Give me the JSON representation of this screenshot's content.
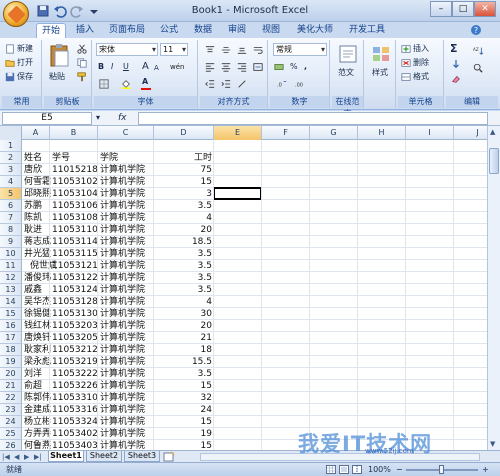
{
  "window": {
    "title": "Book1 - Microsoft Excel",
    "minimize": "–",
    "maximize": "□",
    "close": "✕"
  },
  "tabs": [
    "开始",
    "插入",
    "页面布局",
    "公式",
    "数据",
    "审阅",
    "视图",
    "美化大师",
    "开发工具"
  ],
  "ribbon": {
    "clipboard": {
      "new": "新建",
      "open": "打开",
      "save": "保存",
      "paste": "粘贴",
      "group_common": "常用",
      "group_clipboard": "剪贴板"
    },
    "font": {
      "name": "宋体",
      "size": "11",
      "bold": "B",
      "italic": "I",
      "underline": "U",
      "grow": "A",
      "shrink": "A",
      "fill_color": "A",
      "font_color": "A",
      "group": "字体",
      "phonetic": "wén"
    },
    "alignment": {
      "group": "对齐方式"
    },
    "number": {
      "format": "常规",
      "percent": "%",
      "comma": ",",
      "group": "数字"
    },
    "style": {
      "online_style": "范文",
      "style": "样式",
      "group_online": "在线范文"
    },
    "cells": {
      "insert": "插入",
      "delete": "删除",
      "format": "格式",
      "group": "单元格"
    },
    "editing": {
      "sum": "Σ",
      "group": "编辑"
    }
  },
  "formula_bar": {
    "name_box": "E5",
    "fx": "fx"
  },
  "columns": [
    "A",
    "B",
    "C",
    "D",
    "E",
    "F",
    "G",
    "H",
    "I",
    "J"
  ],
  "active_cell": {
    "col": "E",
    "row": "5"
  },
  "rows": [
    {
      "n": "1",
      "a": "",
      "b": "",
      "c": "",
      "d": ""
    },
    {
      "n": "2",
      "a": "姓名",
      "b": "学号",
      "c": "学院",
      "d": "工时"
    },
    {
      "n": "3",
      "a": "唐欣",
      "b": "11015218",
      "c": "计算机学院",
      "d": "75"
    },
    {
      "n": "4",
      "a": "何雪霜",
      "b": "11053102",
      "c": "计算机学院",
      "d": "15"
    },
    {
      "n": "5",
      "a": "邱晓熙",
      "b": "11053104",
      "c": "计算机学院",
      "d": "3"
    },
    {
      "n": "6",
      "a": "苏鹏",
      "b": "11053106",
      "c": "计算机学院",
      "d": "3.5"
    },
    {
      "n": "7",
      "a": "陈凯",
      "b": "11053108",
      "c": "计算机学院",
      "d": "4"
    },
    {
      "n": "8",
      "a": "耿进",
      "b": "11053110",
      "c": "计算机学院",
      "d": "20"
    },
    {
      "n": "9",
      "a": "蒋志成",
      "b": "11053114",
      "c": "计算机学院",
      "d": "18.5"
    },
    {
      "n": "10",
      "a": "井光猛",
      "b": "11053115",
      "c": "计算机学院",
      "d": "3.5"
    },
    {
      "n": "11",
      "a": "倪世斌",
      "b": "11053121",
      "c": "计算机学院",
      "d": "3.5"
    },
    {
      "n": "12",
      "a": "潘俊玮",
      "b": "11053122",
      "c": "计算机学院",
      "d": "3.5"
    },
    {
      "n": "13",
      "a": "戚鑫",
      "b": "11053124",
      "c": "计算机学院",
      "d": "3.5"
    },
    {
      "n": "14",
      "a": "吴华杰",
      "b": "11053128",
      "c": "计算机学院",
      "d": "4"
    },
    {
      "n": "15",
      "a": "徐锡健",
      "b": "11053130",
      "c": "计算机学院",
      "d": "30"
    },
    {
      "n": "16",
      "a": "钱红林",
      "b": "11053203",
      "c": "计算机学院",
      "d": "20"
    },
    {
      "n": "17",
      "a": "唐焕钎",
      "b": "11053205",
      "c": "计算机学院",
      "d": "21"
    },
    {
      "n": "18",
      "a": "耿家利",
      "b": "11053212",
      "c": "计算机学院",
      "d": "18"
    },
    {
      "n": "19",
      "a": "梁永彪",
      "b": "11053219",
      "c": "计算机学院",
      "d": "15.5"
    },
    {
      "n": "20",
      "a": "刘洋",
      "b": "11053222",
      "c": "计算机学院",
      "d": "3.5"
    },
    {
      "n": "21",
      "a": "俞超",
      "b": "11053226",
      "c": "计算机学院",
      "d": "15"
    },
    {
      "n": "22",
      "a": "陈郭伟",
      "b": "11053310",
      "c": "计算机学院",
      "d": "32"
    },
    {
      "n": "23",
      "a": "金建成",
      "b": "11053316",
      "c": "计算机学院",
      "d": "24"
    },
    {
      "n": "24",
      "a": "杨立彬",
      "b": "11053324",
      "c": "计算机学院",
      "d": "15"
    },
    {
      "n": "25",
      "a": "方弄弄",
      "b": "11053402",
      "c": "计算机学院",
      "d": "19"
    },
    {
      "n": "26",
      "a": "何鲁燕",
      "b": "11053403",
      "c": "计算机学院",
      "d": "15"
    }
  ],
  "sheets": [
    "Sheet1",
    "Sheet2",
    "Sheet3"
  ],
  "status": {
    "ready": "就绪",
    "zoom": "100%"
  },
  "watermark": {
    "text": "我爱IT技术网",
    "url": "www.52ij.com"
  }
}
